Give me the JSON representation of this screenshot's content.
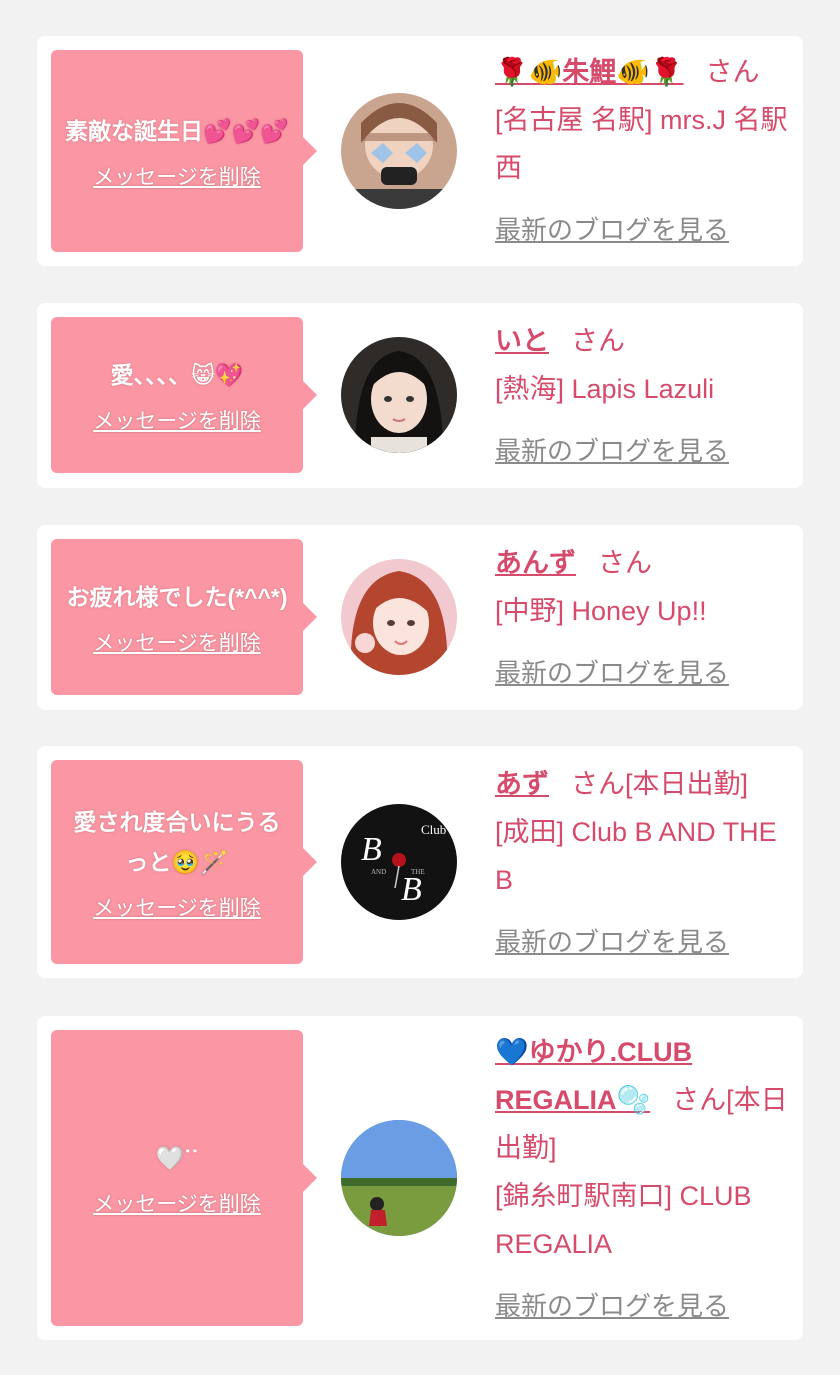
{
  "colors": {
    "page_bg": "#f2f2f2",
    "card_bg": "#ffffff",
    "bubble_bg": "#fb97a4",
    "accent_pink": "#d64b6b",
    "link_gray": "#8a8a8a"
  },
  "delete_label": "メッセージを削除",
  "blog_label": "最新のブログを見る",
  "san_label": "さん",
  "cards": [
    {
      "message": "素敵な誕生日💕💕💕",
      "name": "🌹🐠朱鯉🐠🌹",
      "name_suffix": "",
      "shop": "[名古屋 名駅] mrs.J 名駅西",
      "avatar_icon": "avatar-photo"
    },
    {
      "message": "愛、、、、😸💖",
      "name": "いと",
      "name_suffix": "",
      "shop": "[熱海] Lapis Lazuli",
      "avatar_icon": "avatar-photo"
    },
    {
      "message": "お疲れ様でした(*^^*)",
      "name": "あんず",
      "name_suffix": "",
      "shop": "[中野] Honey Up!!",
      "avatar_icon": "avatar-photo"
    },
    {
      "message": "愛され度合いにうるっと🥹🪄",
      "name": "あず",
      "name_suffix": "[本日出勤]",
      "shop": "[成田] Club B AND THE B",
      "avatar_icon": "club-logo",
      "avatar_text": {
        "club": "Club",
        "b1": "B",
        "b2": "B",
        "and": "AND",
        "the": "THE"
      }
    },
    {
      "message": "🤍ᐝᐝ",
      "name": "💙ゆかり.CLUB REGALIA🫧",
      "name_suffix": "[本日出勤]",
      "shop": "[錦糸町駅南口] CLUB REGALIA",
      "avatar_icon": "avatar-photo"
    }
  ]
}
